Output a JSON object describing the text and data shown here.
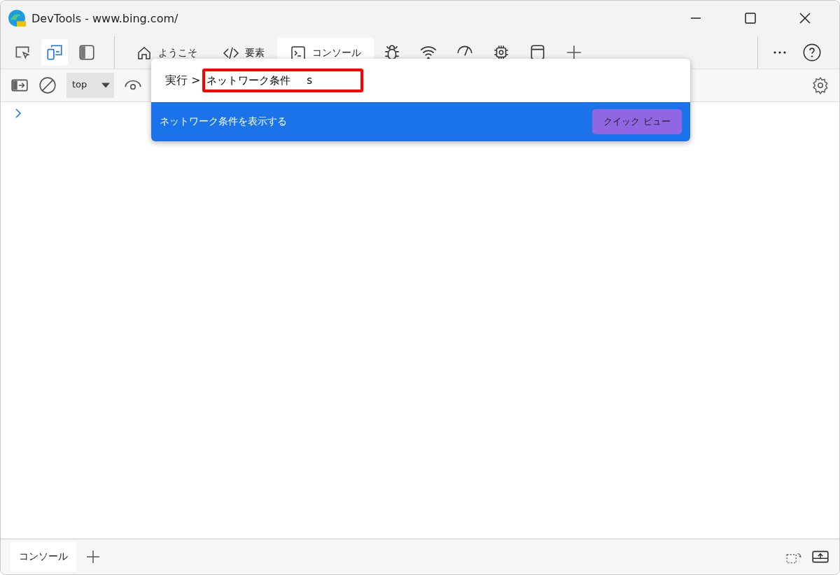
{
  "window": {
    "title": "DevTools - www.bing.com/"
  },
  "tabs": [
    {
      "label": "ようこそ",
      "selected": false
    },
    {
      "label": "要素",
      "selected": false
    },
    {
      "label": "コンソール",
      "selected": true
    }
  ],
  "toolbar": {
    "context": "top"
  },
  "command_menu": {
    "prefix": "実行 >",
    "value": "ネットワーク条件     s",
    "result": "ネットワーク条件を表示する",
    "result_selected": true,
    "quick_view": "クイック ビュー"
  },
  "drawer": {
    "tabs": [
      {
        "label": "コンソール",
        "selected": true
      }
    ]
  }
}
